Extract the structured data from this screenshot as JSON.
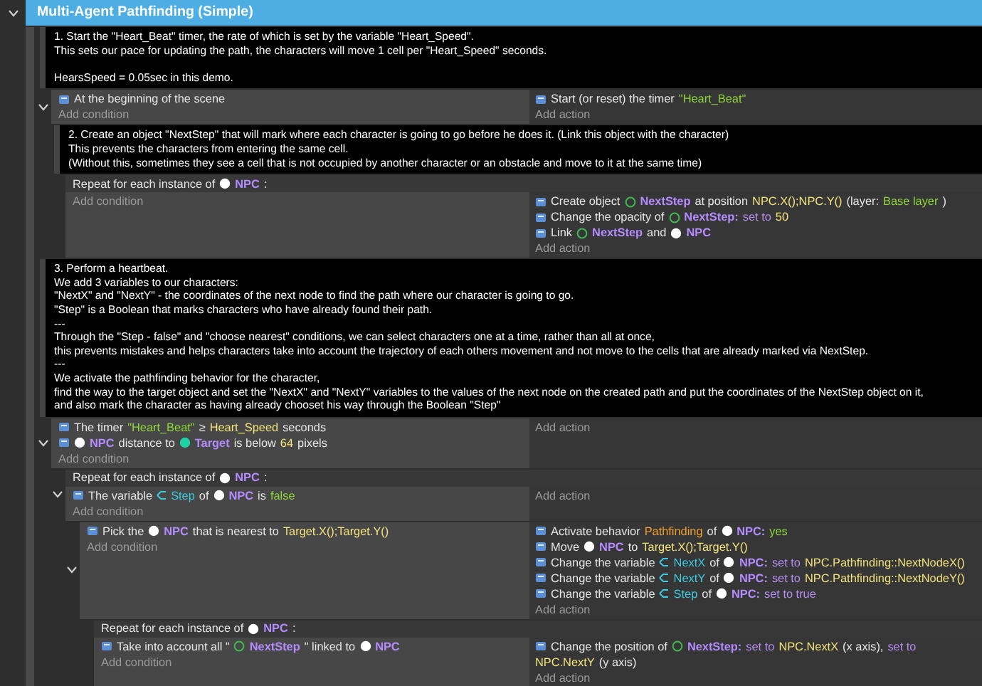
{
  "events": [
    {
      "kind": "group",
      "title": "Multi-Agent Pathfinding (Simple)",
      "expanded": true,
      "children": [
        {
          "kind": "comment",
          "text": "1. Start the \"Heart_Beat\" timer, the rate of which is set by the variable \"Heart_Speed\".\nThis sets our pace for updating the path, the characters will move 1 cell per \"Heart_Speed\" seconds.\n\nHearsSpeed = 0.05sec in this demo."
        },
        {
          "kind": "standard",
          "expanded": true,
          "conditions": [
            [
              {
                "kind": "text",
                "text": "At the beginning of the scene"
              }
            ]
          ],
          "actions": [
            [
              {
                "kind": "text",
                "text": "Start (or reset) the timer"
              },
              {
                "kind": "string",
                "text": "\"Heart_Beat\""
              }
            ]
          ],
          "add_condition": "Add condition",
          "add_action": "Add action",
          "children": [
            {
              "kind": "comment",
              "text": "2. Create an object \"NextStep\" that will mark where each character is going to go before he does it. (Link this object with the character)\nThis prevents the characters from entering the same cell.\n(Without this, sometimes they see a cell that is not occupied by another character or an obstacle and move to it at the same time)"
            },
            {
              "kind": "repeat",
              "header": [
                {
                  "kind": "text",
                  "text": "Repeat for each instance of"
                },
                {
                  "kind": "object",
                  "color": "#ffffff",
                  "text": "NPC"
                },
                {
                  "kind": "text",
                  "text": ":"
                }
              ],
              "actions": [
                [
                  {
                    "kind": "text",
                    "text": "Create object"
                  },
                  {
                    "kind": "object_outline",
                    "color": "#3fb950",
                    "text": "NextStep"
                  },
                  {
                    "kind": "text",
                    "text": "at position"
                  },
                  {
                    "kind": "expr",
                    "text": "NPC.X();NPC.Y()"
                  },
                  {
                    "kind": "text",
                    "text": "(layer:"
                  },
                  {
                    "kind": "string",
                    "text": "Base layer"
                  },
                  {
                    "kind": "text",
                    "text": ")"
                  }
                ],
                [
                  {
                    "kind": "text",
                    "text": "Change the opacity of"
                  },
                  {
                    "kind": "object_outline",
                    "color": "#3fb950",
                    "text": "NextStep:"
                  },
                  {
                    "kind": "keyword",
                    "text": "set to"
                  },
                  {
                    "kind": "expr",
                    "text": "50"
                  }
                ],
                [
                  {
                    "kind": "text",
                    "text": "Link"
                  },
                  {
                    "kind": "object_outline",
                    "color": "#3fb950",
                    "text": "NextStep"
                  },
                  {
                    "kind": "text",
                    "text": "and"
                  },
                  {
                    "kind": "object",
                    "color": "#ffffff",
                    "text": "NPC"
                  }
                ]
              ],
              "add_condition": "Add condition",
              "add_action": "Add action"
            }
          ]
        },
        {
          "kind": "comment",
          "text": "3. Perform a heartbeat.\nWe add 3 variables to our characters:\n\"NextX\" and \"NextY\" - the coordinates of the next node to find the path where our character is going to go.\n\"Step\" is a Boolean that marks characters who have already found their path.\n---\nThrough the \"Step - false\" and \"choose nearest\" conditions, we can select characters one at a time, rather than all at once,\nthis prevents mistakes and helps characters take into account the trajectory of each others movement and not move to the cells that are already marked via NextStep.\n---\nWe activate the pathfinding behavior for the character,\nfind the way to the target object and set the \"NextX\" and \"NextY\" variables to the values of the next node on the created path and put the coordinates of the NextStep object on it,\nand also mark the character as having already chooset his way through the Boolean \"Step\""
        },
        {
          "kind": "standard",
          "expanded": true,
          "conditions": [
            [
              {
                "kind": "text",
                "text": "The timer"
              },
              {
                "kind": "string",
                "text": "\"Heart_Beat\""
              },
              {
                "kind": "text",
                "text": "≥"
              },
              {
                "kind": "expr",
                "text": "Heart_Speed"
              },
              {
                "kind": "text",
                "text": "seconds"
              }
            ],
            [
              {
                "kind": "object",
                "color": "#ffffff",
                "text": "NPC"
              },
              {
                "kind": "text",
                "text": "distance to"
              },
              {
                "kind": "object",
                "color": "#1fd1a5",
                "text": "Target"
              },
              {
                "kind": "text",
                "text": "is below"
              },
              {
                "kind": "expr",
                "text": "64"
              },
              {
                "kind": "text",
                "text": "pixels"
              }
            ]
          ],
          "add_condition": "Add condition",
          "add_action": "Add action",
          "children": [
            {
              "kind": "repeat",
              "expanded": true,
              "header": [
                {
                  "kind": "text",
                  "text": "Repeat for each instance of"
                },
                {
                  "kind": "object",
                  "color": "#ffffff",
                  "text": "NPC"
                },
                {
                  "kind": "text",
                  "text": ":"
                }
              ],
              "conditions": [
                [
                  {
                    "kind": "text",
                    "text": "The variable"
                  },
                  {
                    "kind": "variable",
                    "text": "Step"
                  },
                  {
                    "kind": "text",
                    "text": "of"
                  },
                  {
                    "kind": "object",
                    "color": "#ffffff",
                    "text": "NPC"
                  },
                  {
                    "kind": "text",
                    "text": "is"
                  },
                  {
                    "kind": "value",
                    "text": "false"
                  }
                ]
              ],
              "add_condition": "Add condition",
              "add_action": "Add action",
              "children": [
                {
                  "kind": "standard",
                  "expanded": true,
                  "conditions": [
                    [
                      {
                        "kind": "text",
                        "text": "Pick the"
                      },
                      {
                        "kind": "object",
                        "color": "#ffffff",
                        "text": "NPC"
                      },
                      {
                        "kind": "text",
                        "text": "that is nearest to"
                      },
                      {
                        "kind": "expr",
                        "text": "Target.X();Target.Y()"
                      }
                    ]
                  ],
                  "actions": [
                    [
                      {
                        "kind": "text",
                        "text": "Activate behavior"
                      },
                      {
                        "kind": "behavior",
                        "text": "Pathfinding"
                      },
                      {
                        "kind": "text",
                        "text": "of"
                      },
                      {
                        "kind": "object",
                        "color": "#ffffff",
                        "text": "NPC:"
                      },
                      {
                        "kind": "value",
                        "text": "yes"
                      }
                    ],
                    [
                      {
                        "kind": "text",
                        "text": "Move"
                      },
                      {
                        "kind": "object",
                        "color": "#ffffff",
                        "text": "NPC"
                      },
                      {
                        "kind": "text",
                        "text": "to"
                      },
                      {
                        "kind": "expr",
                        "text": "Target.X();Target.Y()"
                      }
                    ],
                    [
                      {
                        "kind": "text",
                        "text": "Change the variable"
                      },
                      {
                        "kind": "variable",
                        "text": "NextX"
                      },
                      {
                        "kind": "text",
                        "text": "of"
                      },
                      {
                        "kind": "object",
                        "color": "#ffffff",
                        "text": "NPC:"
                      },
                      {
                        "kind": "keyword",
                        "text": "set to"
                      },
                      {
                        "kind": "expr",
                        "text": "NPC.Pathfinding::NextNodeX()"
                      }
                    ],
                    [
                      {
                        "kind": "text",
                        "text": "Change the variable"
                      },
                      {
                        "kind": "variable",
                        "text": "NextY"
                      },
                      {
                        "kind": "text",
                        "text": "of"
                      },
                      {
                        "kind": "object",
                        "color": "#ffffff",
                        "text": "NPC:"
                      },
                      {
                        "kind": "keyword",
                        "text": "set to"
                      },
                      {
                        "kind": "expr",
                        "text": "NPC.Pathfinding::NextNodeY()"
                      }
                    ],
                    [
                      {
                        "kind": "text",
                        "text": "Change the variable"
                      },
                      {
                        "kind": "variable",
                        "text": "Step"
                      },
                      {
                        "kind": "text",
                        "text": "of"
                      },
                      {
                        "kind": "object",
                        "color": "#ffffff",
                        "text": "NPC:"
                      },
                      {
                        "kind": "keyword",
                        "text": "set to true"
                      }
                    ]
                  ],
                  "add_condition": "Add condition",
                  "add_action": "Add action",
                  "children": [
                    {
                      "kind": "repeat",
                      "header": [
                        {
                          "kind": "text",
                          "text": "Repeat for each instance of"
                        },
                        {
                          "kind": "object",
                          "color": "#ffffff",
                          "text": "NPC"
                        },
                        {
                          "kind": "text",
                          "text": ":"
                        }
                      ],
                      "conditions": [
                        [
                          {
                            "kind": "text",
                            "text": "Take into account all \""
                          },
                          {
                            "kind": "object_outline",
                            "color": "#3fb950",
                            "text": "NextStep"
                          },
                          {
                            "kind": "text",
                            "text": "\" linked to"
                          },
                          {
                            "kind": "object",
                            "color": "#ffffff",
                            "text": "NPC"
                          }
                        ]
                      ],
                      "actions": [
                        [
                          {
                            "kind": "text",
                            "text": "Change the position of"
                          },
                          {
                            "kind": "object_outline",
                            "color": "#3fb950",
                            "text": "NextStep:"
                          },
                          {
                            "kind": "keyword",
                            "text": "set to"
                          },
                          {
                            "kind": "expr",
                            "text": "NPC.NextX"
                          },
                          {
                            "kind": "text",
                            "text": "(x axis),"
                          },
                          {
                            "kind": "keyword",
                            "text": "set to"
                          },
                          {
                            "kind": "expr",
                            "text": "NPC.NextY"
                          },
                          {
                            "kind": "text",
                            "text": "(y axis)"
                          }
                        ]
                      ],
                      "add_condition": "Add condition",
                      "add_action": "Add action"
                    }
                  ]
                }
              ]
            }
          ]
        }
      ]
    }
  ]
}
